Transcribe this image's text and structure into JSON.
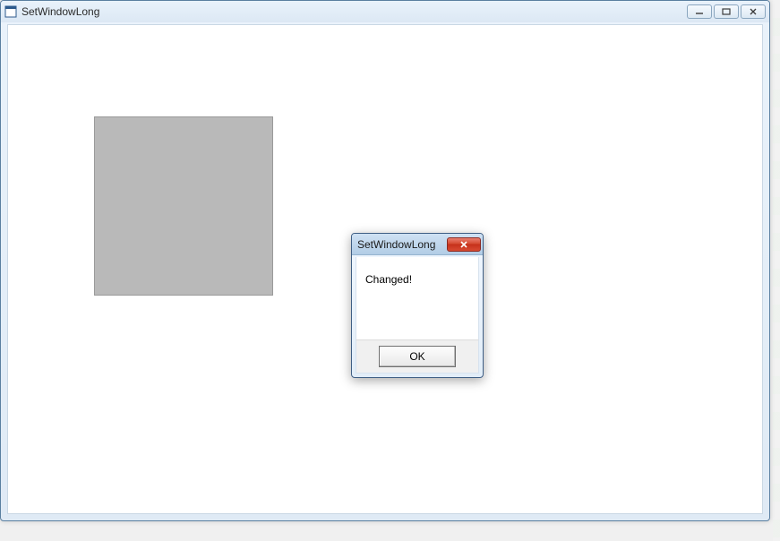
{
  "mainWindow": {
    "title": "SetWindowLong",
    "controls": {
      "minimizeGlyph": "─",
      "maximizeGlyph": "□",
      "closeGlyph": "✕"
    }
  },
  "messageBox": {
    "title": "SetWindowLong",
    "bodyText": "Changed!",
    "okLabel": "OK",
    "closeGlyph": "✕"
  },
  "colors": {
    "childPanelBg": "#b9b9b9",
    "closeBtnBg": "#d4492f"
  }
}
